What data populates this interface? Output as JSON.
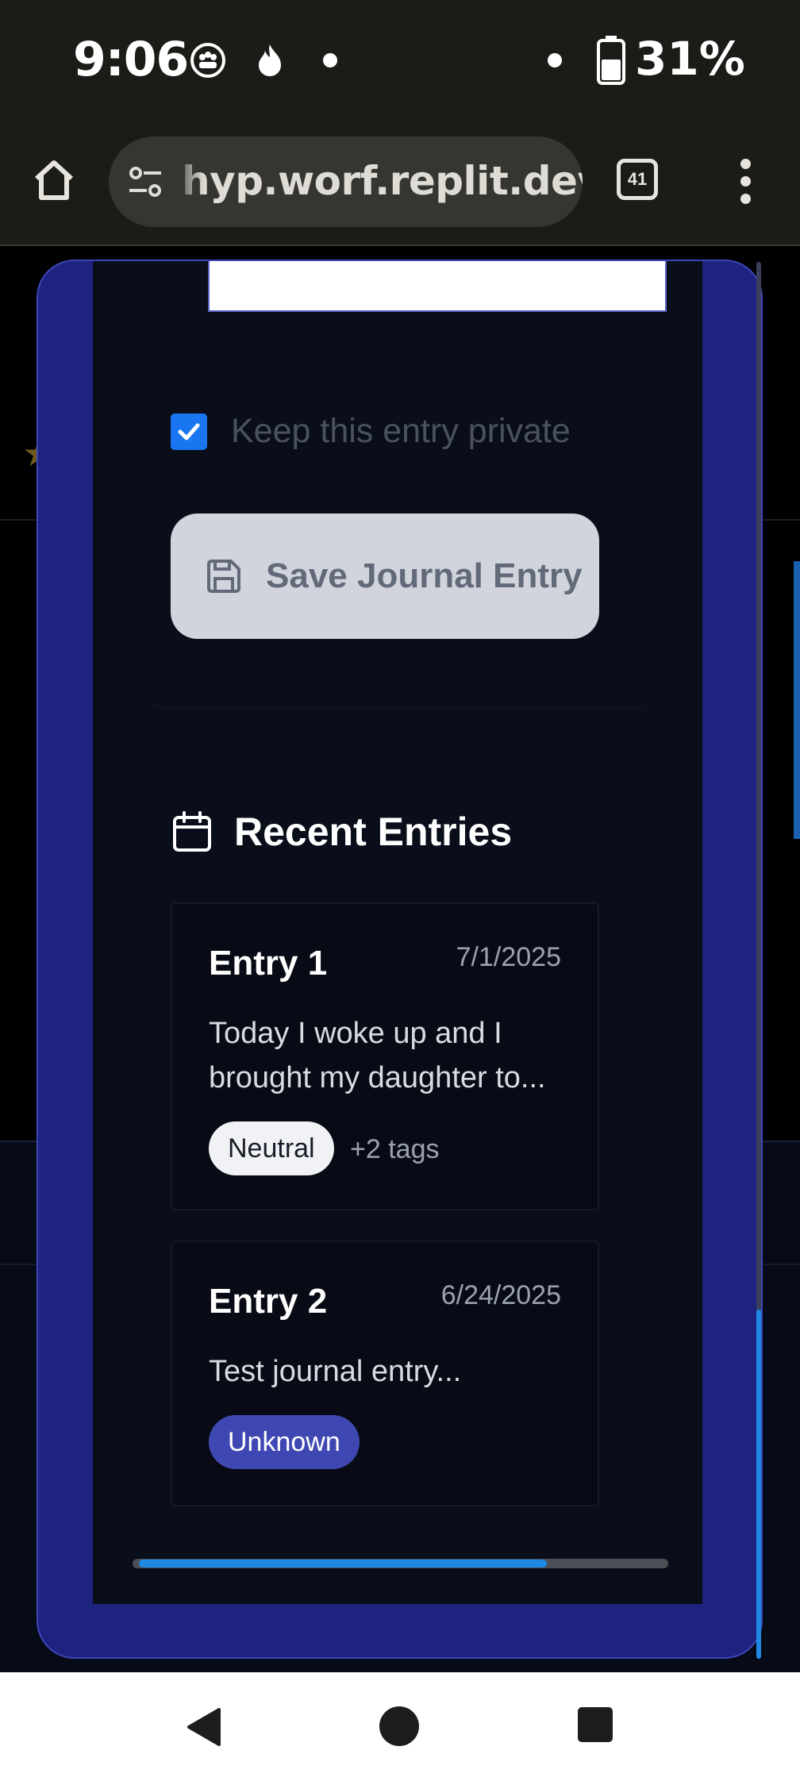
{
  "status_bar": {
    "time": "9:06",
    "battery": "31%"
  },
  "browser": {
    "url": "hyp.worf.replit.dev",
    "tab_count": "41"
  },
  "form": {
    "private_label": "Keep this entry private",
    "private_checked": true,
    "save_label": "Save Journal Entry"
  },
  "recent": {
    "title": "Recent Entries",
    "entries": [
      {
        "title": "Entry 1",
        "date": "7/1/2025",
        "snippet": "Today I woke up and I brought my daughter to...",
        "badge": "Neutral",
        "more_tags": "+2 tags"
      },
      {
        "title": "Entry 2",
        "date": "6/24/2025",
        "snippet": "Test journal entry...",
        "badge": "Unknown"
      }
    ]
  },
  "colors": {
    "modal_border": "#1d237e",
    "accent_blue": "#1976f0",
    "badge_unknown": "#3f48b2"
  }
}
